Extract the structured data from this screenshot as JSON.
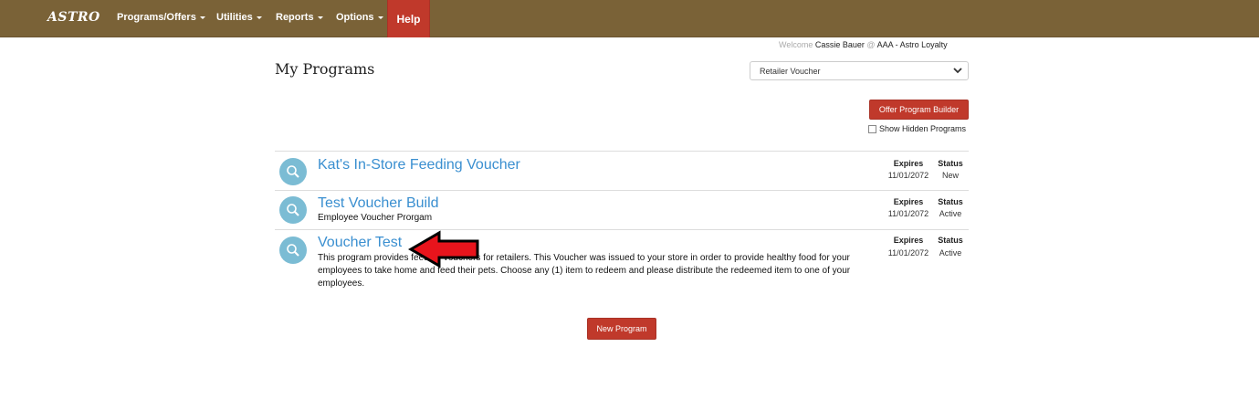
{
  "nav": {
    "brand": "ASTRO",
    "items": [
      "Programs/Offers",
      "Utilities",
      "Reports",
      "Options"
    ],
    "help": "Help"
  },
  "welcome": {
    "prefix": "Welcome",
    "user": "Cassie Bauer",
    "at": "@",
    "org": "AAA - Astro Loyalty"
  },
  "page": {
    "title": "My Programs",
    "program_type": "Retailer Voucher",
    "offer_builder": "Offer Program Builder",
    "show_hidden": "Show Hidden Programs",
    "new_program": "New Program",
    "expires_label": "Expires",
    "status_label": "Status"
  },
  "programs": [
    {
      "title": "Kat's In-Store Feeding Voucher",
      "description": "",
      "expires": "11/01/2072",
      "status": "New"
    },
    {
      "title": "Test Voucher Build",
      "description": "Employee Voucher Prorgam",
      "expires": "11/01/2072",
      "status": "Active"
    },
    {
      "title": "Voucher Test",
      "description": "This program provides feeding vouchers for retailers. This Voucher was issued to your store in order to provide healthy food for your employees to take home and feed their pets. Choose any (1) item to redeem and please distribute the redeemed item to one of your employees.",
      "expires": "11/01/2072",
      "status": "Active"
    }
  ],
  "colors": {
    "navbar": "#7a6237",
    "accent_red": "#c0392b",
    "link_blue": "#3a8fd0",
    "icon_blue": "#7bbcd4"
  },
  "icons": {
    "program_icon": "search-icon",
    "annotation": "red-arrow-icon"
  }
}
